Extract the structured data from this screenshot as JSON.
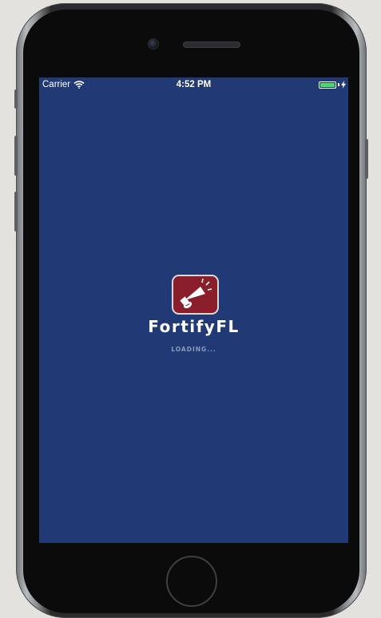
{
  "status_bar": {
    "carrier": "Carrier",
    "time": "4:52 PM",
    "battery_level": 1.0
  },
  "splash": {
    "app_name": "FortifyFL",
    "loading_text": "LOADING...",
    "logo_icon": "megaphone-football-icon"
  },
  "colors": {
    "screen_background": "#213974",
    "logo_background": "#8a1e2b",
    "battery_fill": "#4cd964"
  }
}
